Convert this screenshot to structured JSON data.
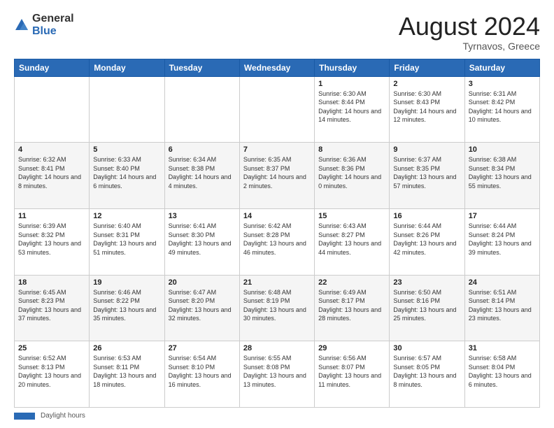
{
  "logo": {
    "general": "General",
    "blue": "Blue"
  },
  "title": "August 2024",
  "subtitle": "Tyrnavos, Greece",
  "days_of_week": [
    "Sunday",
    "Monday",
    "Tuesday",
    "Wednesday",
    "Thursday",
    "Friday",
    "Saturday"
  ],
  "footer_label": "Daylight hours",
  "weeks": [
    [
      {
        "day": "",
        "info": ""
      },
      {
        "day": "",
        "info": ""
      },
      {
        "day": "",
        "info": ""
      },
      {
        "day": "",
        "info": ""
      },
      {
        "day": "1",
        "info": "Sunrise: 6:30 AM\nSunset: 8:44 PM\nDaylight: 14 hours and 14 minutes."
      },
      {
        "day": "2",
        "info": "Sunrise: 6:30 AM\nSunset: 8:43 PM\nDaylight: 14 hours and 12 minutes."
      },
      {
        "day": "3",
        "info": "Sunrise: 6:31 AM\nSunset: 8:42 PM\nDaylight: 14 hours and 10 minutes."
      }
    ],
    [
      {
        "day": "4",
        "info": "Sunrise: 6:32 AM\nSunset: 8:41 PM\nDaylight: 14 hours and 8 minutes."
      },
      {
        "day": "5",
        "info": "Sunrise: 6:33 AM\nSunset: 8:40 PM\nDaylight: 14 hours and 6 minutes."
      },
      {
        "day": "6",
        "info": "Sunrise: 6:34 AM\nSunset: 8:38 PM\nDaylight: 14 hours and 4 minutes."
      },
      {
        "day": "7",
        "info": "Sunrise: 6:35 AM\nSunset: 8:37 PM\nDaylight: 14 hours and 2 minutes."
      },
      {
        "day": "8",
        "info": "Sunrise: 6:36 AM\nSunset: 8:36 PM\nDaylight: 14 hours and 0 minutes."
      },
      {
        "day": "9",
        "info": "Sunrise: 6:37 AM\nSunset: 8:35 PM\nDaylight: 13 hours and 57 minutes."
      },
      {
        "day": "10",
        "info": "Sunrise: 6:38 AM\nSunset: 8:34 PM\nDaylight: 13 hours and 55 minutes."
      }
    ],
    [
      {
        "day": "11",
        "info": "Sunrise: 6:39 AM\nSunset: 8:32 PM\nDaylight: 13 hours and 53 minutes."
      },
      {
        "day": "12",
        "info": "Sunrise: 6:40 AM\nSunset: 8:31 PM\nDaylight: 13 hours and 51 minutes."
      },
      {
        "day": "13",
        "info": "Sunrise: 6:41 AM\nSunset: 8:30 PM\nDaylight: 13 hours and 49 minutes."
      },
      {
        "day": "14",
        "info": "Sunrise: 6:42 AM\nSunset: 8:28 PM\nDaylight: 13 hours and 46 minutes."
      },
      {
        "day": "15",
        "info": "Sunrise: 6:43 AM\nSunset: 8:27 PM\nDaylight: 13 hours and 44 minutes."
      },
      {
        "day": "16",
        "info": "Sunrise: 6:44 AM\nSunset: 8:26 PM\nDaylight: 13 hours and 42 minutes."
      },
      {
        "day": "17",
        "info": "Sunrise: 6:44 AM\nSunset: 8:24 PM\nDaylight: 13 hours and 39 minutes."
      }
    ],
    [
      {
        "day": "18",
        "info": "Sunrise: 6:45 AM\nSunset: 8:23 PM\nDaylight: 13 hours and 37 minutes."
      },
      {
        "day": "19",
        "info": "Sunrise: 6:46 AM\nSunset: 8:22 PM\nDaylight: 13 hours and 35 minutes."
      },
      {
        "day": "20",
        "info": "Sunrise: 6:47 AM\nSunset: 8:20 PM\nDaylight: 13 hours and 32 minutes."
      },
      {
        "day": "21",
        "info": "Sunrise: 6:48 AM\nSunset: 8:19 PM\nDaylight: 13 hours and 30 minutes."
      },
      {
        "day": "22",
        "info": "Sunrise: 6:49 AM\nSunset: 8:17 PM\nDaylight: 13 hours and 28 minutes."
      },
      {
        "day": "23",
        "info": "Sunrise: 6:50 AM\nSunset: 8:16 PM\nDaylight: 13 hours and 25 minutes."
      },
      {
        "day": "24",
        "info": "Sunrise: 6:51 AM\nSunset: 8:14 PM\nDaylight: 13 hours and 23 minutes."
      }
    ],
    [
      {
        "day": "25",
        "info": "Sunrise: 6:52 AM\nSunset: 8:13 PM\nDaylight: 13 hours and 20 minutes."
      },
      {
        "day": "26",
        "info": "Sunrise: 6:53 AM\nSunset: 8:11 PM\nDaylight: 13 hours and 18 minutes."
      },
      {
        "day": "27",
        "info": "Sunrise: 6:54 AM\nSunset: 8:10 PM\nDaylight: 13 hours and 16 minutes."
      },
      {
        "day": "28",
        "info": "Sunrise: 6:55 AM\nSunset: 8:08 PM\nDaylight: 13 hours and 13 minutes."
      },
      {
        "day": "29",
        "info": "Sunrise: 6:56 AM\nSunset: 8:07 PM\nDaylight: 13 hours and 11 minutes."
      },
      {
        "day": "30",
        "info": "Sunrise: 6:57 AM\nSunset: 8:05 PM\nDaylight: 13 hours and 8 minutes."
      },
      {
        "day": "31",
        "info": "Sunrise: 6:58 AM\nSunset: 8:04 PM\nDaylight: 13 hours and 6 minutes."
      }
    ]
  ]
}
